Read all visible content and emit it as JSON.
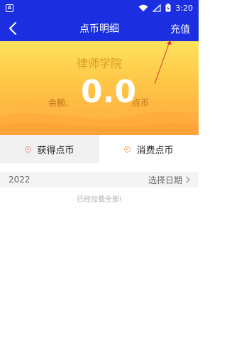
{
  "status_bar": {
    "app_icon_letter": "A",
    "time": "3:20",
    "icons": [
      "wifi-icon",
      "signal-icon",
      "battery-icon"
    ]
  },
  "nav": {
    "title": "点币明细",
    "recharge_label": "充值",
    "back_icon": "chevron-left-icon"
  },
  "hero": {
    "title": "律师学院",
    "balance_label": "余额:",
    "balance_value": "0.0",
    "balance_unit": "点币"
  },
  "tabs": [
    {
      "label": "获得点币",
      "selected": true
    },
    {
      "label": "消费点币",
      "selected": false
    }
  ],
  "filter": {
    "year": "2022",
    "date_select_label": "选择日期"
  },
  "list": {
    "end_text": "已经加载全部!"
  },
  "colors": {
    "header_blue": "#1b2fe0",
    "hero_top": "#ffe35d",
    "hero_bottom": "#fca93c",
    "annotation_red": "#d9342b"
  }
}
